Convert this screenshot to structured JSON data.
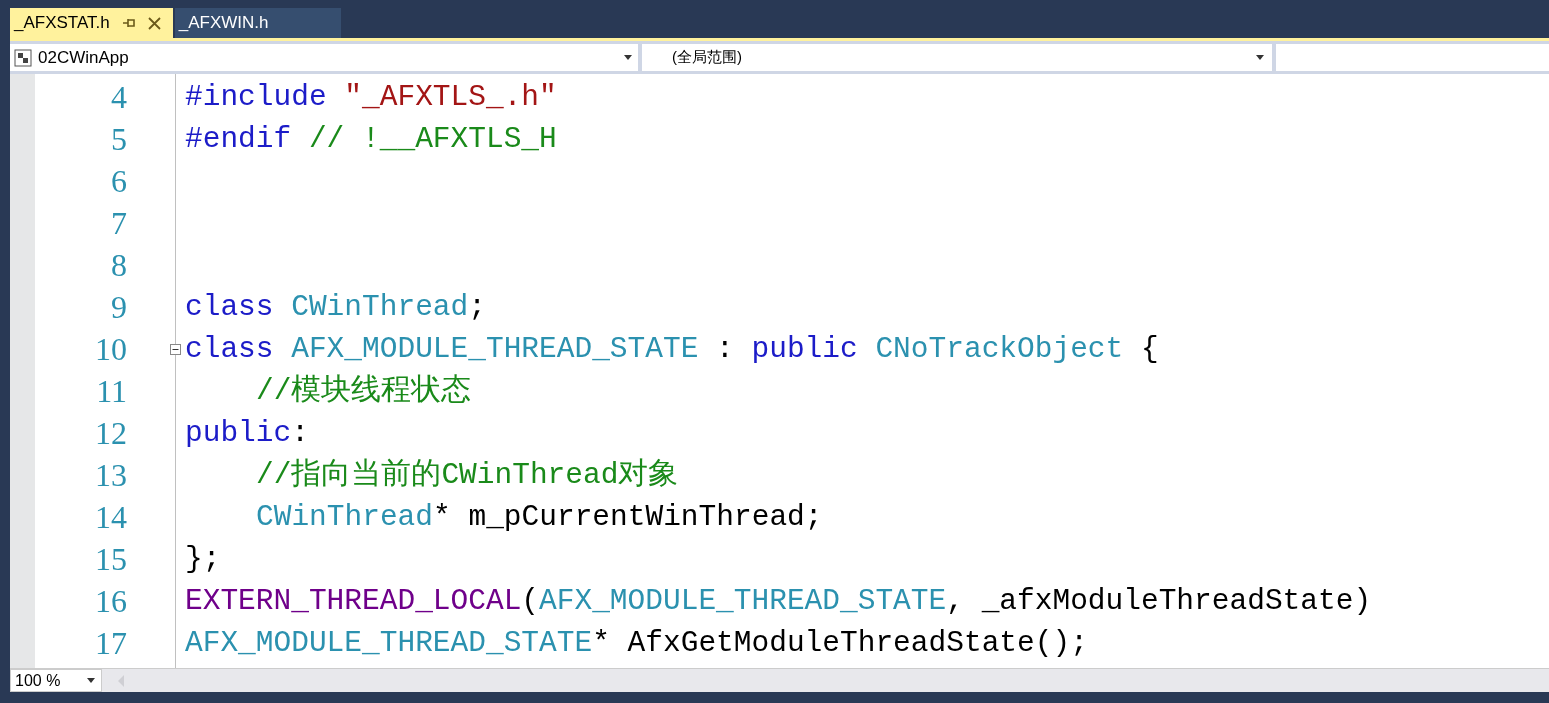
{
  "tabs": [
    {
      "label": "_AFXSTAT.h",
      "selected": true,
      "pinned": true,
      "closable": true
    },
    {
      "label": "_AFXWIN.h",
      "selected": false
    }
  ],
  "nav": {
    "project": "02CWinApp",
    "scope": "(全局范围)"
  },
  "code": [
    {
      "number": "4",
      "tokens": [
        {
          "kind": "keyword",
          "text": "#include "
        },
        {
          "kind": "string",
          "text": "\"_AFXTLS_.h\""
        }
      ]
    },
    {
      "number": "5",
      "tokens": [
        {
          "kind": "keyword",
          "text": "#endif "
        },
        {
          "kind": "comment",
          "text": "// !__AFXTLS_H"
        }
      ]
    },
    {
      "number": "6"
    },
    {
      "number": "7"
    },
    {
      "number": "8"
    },
    {
      "number": "9",
      "tokens": [
        {
          "kind": "keyword",
          "text": "class "
        },
        {
          "kind": "type",
          "text": "CWinThread"
        },
        {
          "kind": "plain",
          "text": ";"
        }
      ]
    },
    {
      "number": "10",
      "collapsible": true,
      "tokens": [
        {
          "kind": "keyword",
          "text": "class "
        },
        {
          "kind": "type",
          "text": "AFX_MODULE_THREAD_STATE"
        },
        {
          "kind": "plain",
          "text": " : "
        },
        {
          "kind": "keyword",
          "text": "public "
        },
        {
          "kind": "type",
          "text": "CNoTrackObject"
        },
        {
          "kind": "plain",
          "text": " {"
        }
      ]
    },
    {
      "number": "11",
      "indented": true,
      "tokens": [
        {
          "kind": "comment",
          "text": "//模块线程状态"
        }
      ]
    },
    {
      "number": "12",
      "tokens": [
        {
          "kind": "keyword",
          "text": "public"
        },
        {
          "kind": "plain",
          "text": ":"
        }
      ]
    },
    {
      "number": "13",
      "indented": true,
      "tokens": [
        {
          "kind": "comment",
          "text": "//指向当前的CWinThread对象"
        }
      ]
    },
    {
      "number": "14",
      "indented": true,
      "tokens": [
        {
          "kind": "type",
          "text": "CWinThread"
        },
        {
          "kind": "plain",
          "text": "* m_pCurrentWinThread;"
        }
      ]
    },
    {
      "number": "15",
      "tokens": [
        {
          "kind": "plain",
          "text": "};"
        }
      ]
    },
    {
      "number": "16",
      "tokens": [
        {
          "kind": "macro",
          "text": "EXTERN_THREAD_LOCAL"
        },
        {
          "kind": "plain",
          "text": "("
        },
        {
          "kind": "type",
          "text": "AFX_MODULE_THREAD_STATE"
        },
        {
          "kind": "plain",
          "text": ", _afxModuleThreadState)"
        }
      ]
    },
    {
      "number": "17",
      "tokens": [
        {
          "kind": "type",
          "text": "AFX_MODULE_THREAD_STATE"
        },
        {
          "kind": "plain",
          "text": "* AfxGetModuleThreadState();"
        }
      ]
    }
  ],
  "zoom": "100 %"
}
